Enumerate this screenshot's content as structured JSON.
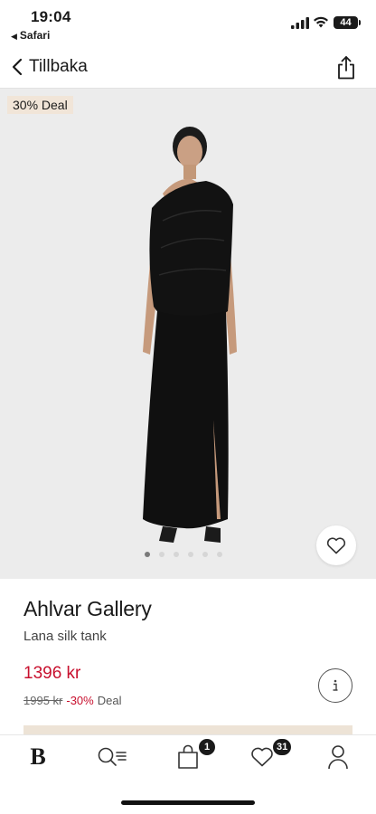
{
  "status_bar": {
    "time": "19:04",
    "back_app": "Safari",
    "battery": "44"
  },
  "nav": {
    "back_label": "Tillbaka",
    "share_icon": "share-icon"
  },
  "product": {
    "deal_badge": "30% Deal",
    "brand": "Ahlvar Gallery",
    "name": "Lana silk tank",
    "price": "1396 kr",
    "old_price": "1995 kr",
    "discount": "-30%",
    "deal_label": "Deal",
    "image_count": 6,
    "active_image": 1
  },
  "tab_bar": {
    "home_logo": "B",
    "cart_count": "1",
    "wishlist_count": "31"
  },
  "colors": {
    "price_red": "#c8102e",
    "badge_beige": "#f1e5d8",
    "image_bg": "#ececec"
  }
}
